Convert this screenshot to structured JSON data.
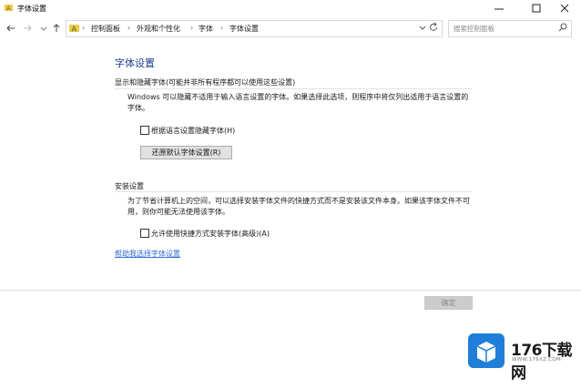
{
  "window": {
    "title": "字体设置"
  },
  "address": {
    "crumbs": [
      "控制面板",
      "外观和个性化",
      "字体",
      "字体设置"
    ],
    "separator": "›"
  },
  "search": {
    "placeholder": "搜索控制面板"
  },
  "content": {
    "heading": "字体设置",
    "show_hide": {
      "title": "显示和隐藏字体(可能并非所有程序都可以使用这些设置)",
      "desc": "Windows 可以隐藏不适用于输入语言设置的字体。如果选择此选项，则程序中将仅列出适用于语言设置的字体。",
      "checkbox_label": "根据语言设置隐藏字体(H)",
      "checkbox_checked": false,
      "restore_button": "还原默认字体设置(R)"
    },
    "install": {
      "title": "安装设置",
      "desc": "为了节省计算机上的空间，可以选择安装字体文件的快捷方式而不是安装该文件本身。如果该字体文件不可用，则你可能无法使用该字体。",
      "checkbox_label": "允许使用快捷方式安装字体(高级)(A)",
      "checkbox_checked": false
    },
    "link": "帮助我选择字体设置"
  },
  "footer": {
    "ok_button": "确定"
  },
  "watermark": {
    "brand": "176下载网",
    "url": "WWW.176XZ.COM"
  },
  "colors": {
    "heading": "#1e3d8f",
    "link": "#2f6fd2",
    "watermark_blue": "#1f7fd8"
  },
  "icons": [
    "font-folder-icon",
    "minimize-icon",
    "maximize-icon",
    "close-icon",
    "back-arrow-icon",
    "forward-arrow-icon",
    "recent-dropdown-icon",
    "up-arrow-icon",
    "address-dropdown-icon",
    "refresh-icon",
    "search-icon"
  ]
}
